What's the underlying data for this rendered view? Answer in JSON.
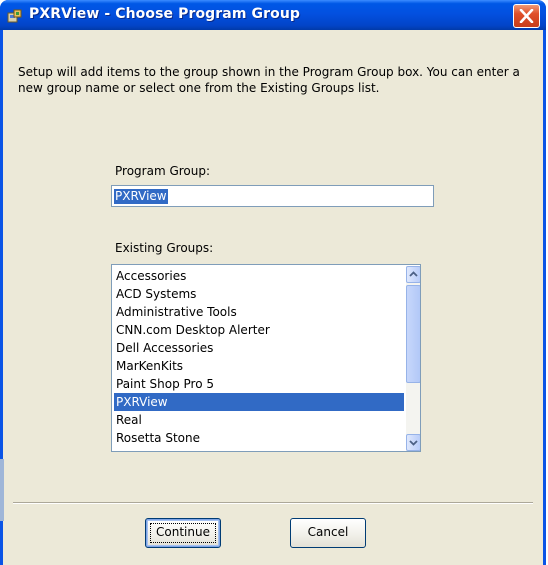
{
  "window": {
    "title": "PXRView - Choose Program Group"
  },
  "intro_text": "Setup will add items to the group shown in the Program Group box. You can enter a new group name or select one from the Existing Groups list.",
  "program_group": {
    "label": "Program Group:",
    "value": "PXRView"
  },
  "existing_groups": {
    "label": "Existing Groups:",
    "items": [
      "Accessories",
      "ACD Systems",
      "Administrative Tools",
      "CNN.com Desktop Alerter",
      "Dell Accessories",
      "MarKenKits",
      "Paint Shop Pro 5",
      "PXRView",
      "Real",
      "Rosetta Stone"
    ],
    "selected": "PXRView"
  },
  "buttons": {
    "continue": "Continue",
    "cancel": "Cancel"
  },
  "colors": {
    "titlebar": "#0350e0",
    "selection": "#316ac5",
    "client_bg": "#ece9d8",
    "close": "#e0502a"
  },
  "icons": {
    "app": "setup-app-icon",
    "close": "close-icon",
    "scroll_up": "arrow-up-icon",
    "scroll_down": "arrow-down-icon"
  }
}
